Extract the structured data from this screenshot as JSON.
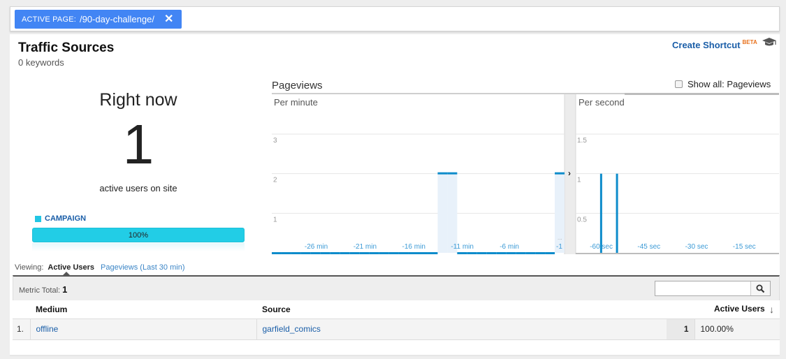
{
  "filter": {
    "key": "ACTIVE PAGE:",
    "value": "/90-day-challenge/",
    "remove_icon": "close-icon"
  },
  "header": {
    "title": "Traffic Sources",
    "subtitle": "0 keywords",
    "shortcut_label": "Create Shortcut",
    "shortcut_badge": "BETA",
    "academy_icon": "graduation-cap-icon"
  },
  "summary": {
    "heading": "Right now",
    "count": "1",
    "caption": "active users on site",
    "legend_label": "CAMPAIGN",
    "legend_color": "#22c6e4",
    "bar_label": "100%",
    "bar_fraction": 1.0
  },
  "pageviews": {
    "title": "Pageviews",
    "show_all_label": "Show all: Pageviews",
    "show_all_checked": false
  },
  "chart_data": [
    {
      "type": "bar",
      "title": "Per minute",
      "xlabel": "",
      "ylabel": "Pageviews",
      "x_range": [
        -30,
        0
      ],
      "ylim": [
        0,
        4
      ],
      "yticks": [
        1,
        2,
        3
      ],
      "ytick_labels": [
        "1",
        "2",
        "3"
      ],
      "xticks": [
        -26,
        -21,
        -16,
        -11,
        -6,
        -1
      ],
      "xtick_labels": [
        "-26 min",
        "-21 min",
        "-16 min",
        "-11 min",
        "-6 min",
        "-1"
      ],
      "grid": true,
      "x": [
        -30,
        -29,
        -28,
        -27,
        -26,
        -25,
        -24,
        -23,
        -22,
        -21,
        -20,
        -19,
        -18,
        -17,
        -16,
        -15,
        -14,
        -13,
        -12,
        -11,
        -10,
        -9,
        -8,
        -7,
        -6,
        -5,
        -4,
        -3,
        -2,
        -1
      ],
      "values": [
        0,
        0,
        0,
        0,
        0,
        0,
        0,
        0,
        0,
        0,
        0,
        0,
        0,
        0,
        0,
        0,
        0,
        2,
        2,
        0,
        0,
        0,
        0,
        0,
        0,
        0,
        0,
        0,
        0,
        2
      ],
      "color": "#0e8ccb",
      "highlight_color": "#e8f1fa"
    },
    {
      "type": "bar",
      "title": "Per second",
      "xlabel": "",
      "ylabel": "Pageviews",
      "x_range": [
        -64,
        0
      ],
      "ylim": [
        0,
        2
      ],
      "yticks": [
        0.5,
        1,
        1.5
      ],
      "ytick_labels": [
        "0.5",
        "1",
        "1.5"
      ],
      "xticks": [
        -60,
        -45,
        -30,
        -15
      ],
      "xtick_labels": [
        "-60 sec",
        "-45 sec",
        "-30 sec",
        "-15 sec"
      ],
      "grid": true,
      "x": [
        -56,
        -51
      ],
      "values": [
        1,
        1
      ],
      "color": "#0e8ccb"
    }
  ],
  "viewing": {
    "label": "Viewing:",
    "active": "Active Users",
    "other": "Pageviews (Last 30 min)"
  },
  "table": {
    "metric_total_label": "Metric Total:",
    "metric_total_value": "1",
    "search_placeholder": "",
    "columns": [
      "Medium",
      "Source",
      "Active Users"
    ],
    "sort_icon": "arrow-down-icon",
    "rows": [
      {
        "index": "1.",
        "medium": "offline",
        "source": "garfield_comics",
        "active_users": "1",
        "percent": "100.00%"
      }
    ]
  }
}
